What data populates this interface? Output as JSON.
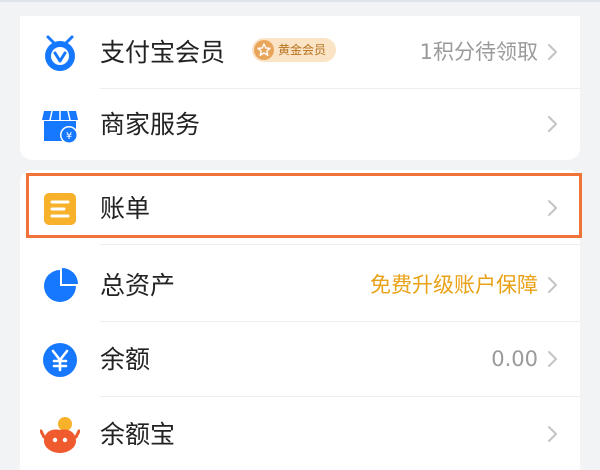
{
  "colors": {
    "accent_blue": "#1677ff",
    "bill_yellow": "#f7b12a",
    "promo_orange": "#e9a116",
    "highlight_border": "#f27338",
    "badge_bg": "#fbe3c6"
  },
  "card1": {
    "member": {
      "label": "支付宝会员",
      "icon": "alipay-member-icon",
      "badge": "黄金会员",
      "badge_icon": "star-icon",
      "right_text": "1积分待领取"
    },
    "merchant": {
      "label": "商家服务",
      "icon": "shop-icon"
    }
  },
  "card2": {
    "bill": {
      "label": "账单",
      "icon": "bill-icon",
      "highlighted": true
    },
    "assets": {
      "label": "总资产",
      "icon": "pie-chart-icon",
      "right_text": "免费升级账户保障"
    },
    "balance": {
      "label": "余额",
      "icon": "yuan-icon",
      "right_text": "0.00"
    },
    "yuebao": {
      "label": "余额宝",
      "icon": "yuebao-icon"
    }
  }
}
